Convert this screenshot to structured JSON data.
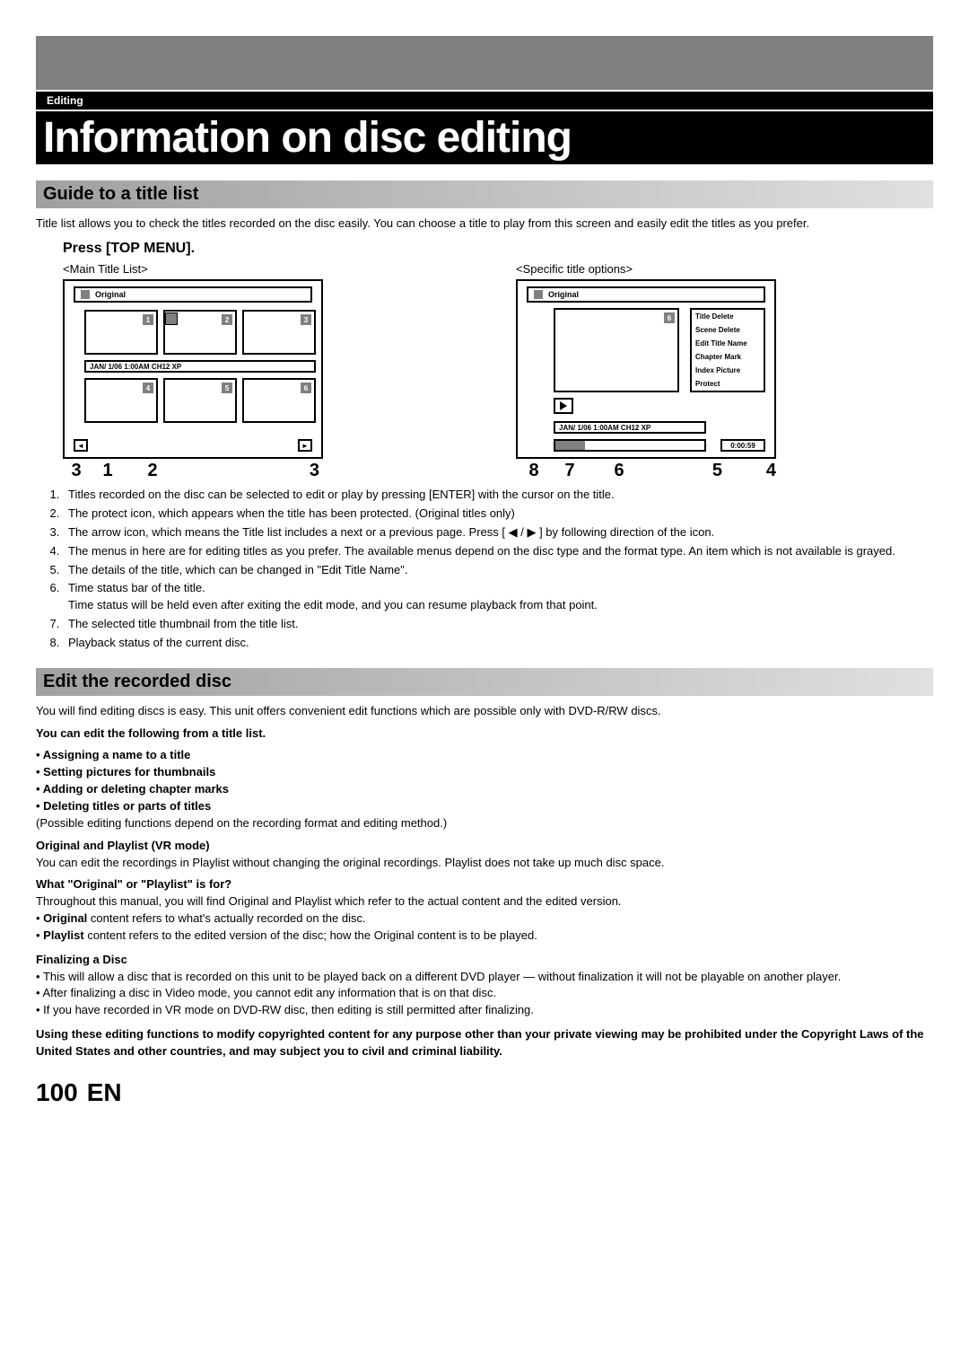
{
  "header": {
    "section_label": "Editing",
    "page_title": "Information on disc editing"
  },
  "section1": {
    "heading": "Guide to a title list",
    "intro": "Title list allows you to check the titles recorded on the disc easily. You can choose a title to play from this screen and easily edit the titles as you prefer.",
    "press": "Press [TOP MENU].",
    "diagram_left_label": "<Main Title List>",
    "diagram_right_label": "<Specific title options>",
    "original_label": "Original",
    "info_strip": "JAN/ 1/06 1:00AM CH12 XP",
    "thumbs": [
      "1",
      "2",
      "3",
      "4",
      "5",
      "6"
    ],
    "big_thumb_num": "6",
    "menu_items": [
      "Title Delete",
      "Scene Delete",
      "Edit Title Name",
      "Chapter Mark",
      "Index Picture",
      "Protect"
    ],
    "duration": "0:00:59",
    "callouts_left": [
      "3",
      "1",
      "2",
      "3"
    ],
    "callouts_right": [
      "8",
      "7",
      "6",
      "5",
      "4"
    ],
    "notes": [
      "Titles recorded on the disc can be selected to edit or play by pressing [ENTER] with the cursor on the title.",
      "The protect icon, which appears when the title has been protected. (Original titles only)",
      "The arrow icon, which means the Title list includes a next or a previous page. Press [ ◀ / ▶ ] by following direction of the icon.",
      "The menus in here are for editing titles as you prefer. The available menus depend on the disc type and the format type. An item which is not available is grayed.",
      "The details of the title, which can be changed in \"Edit Title Name\".",
      "Time status bar of the title.\nTime status will be held even after exiting the edit mode, and you can resume playback from that point.",
      "The selected title thumbnail from the title list.",
      "Playback status of the current disc."
    ]
  },
  "section2": {
    "heading": "Edit the recorded disc",
    "intro": "You will find editing discs is easy. This unit offers convenient edit functions which are possible only with DVD-R/RW discs.",
    "can_edit_heading": "You can edit the following from a title list.",
    "can_edit_items": [
      "Assigning a name to a title",
      "Setting pictures for thumbnails",
      "Adding or deleting chapter marks",
      "Deleting titles or parts of titles"
    ],
    "possible_note": "(Possible editing functions depend on the recording format and editing method.)",
    "vr_heading": "Original and Playlist (VR mode)",
    "vr_text": "You can edit the recordings in Playlist without changing the original recordings. Playlist does not take up much disc space.",
    "what_heading": "What \"Original\" or \"Playlist\" is for?",
    "what_text": "Throughout this manual, you will find Original and Playlist which refer to the actual content and the edited version.",
    "orig_bullet_label": "Original",
    "orig_bullet_text": " content refers to what's actually recorded on the disc.",
    "pl_bullet_label": "Playlist",
    "pl_bullet_text": " content refers to the edited version of the disc; how the Original content is to be played.",
    "finalize_heading": "Finalizing a Disc",
    "finalize_items": [
      "This will allow a disc that is recorded on this unit to be played back on a different DVD player — without finalization it will not be playable on another player.",
      "After finalizing a disc in Video mode, you cannot edit any information that is on that disc.",
      "If you have recorded in VR mode on DVD-RW disc, then editing is still permitted after finalizing."
    ],
    "warning": "Using these editing functions to modify copyrighted content for any purpose other than your private viewing may be prohibited under the Copyright Laws of the United States and other countries, and may subject you to civil and criminal liability."
  },
  "footer": {
    "page_num": "100",
    "lang": "EN"
  }
}
